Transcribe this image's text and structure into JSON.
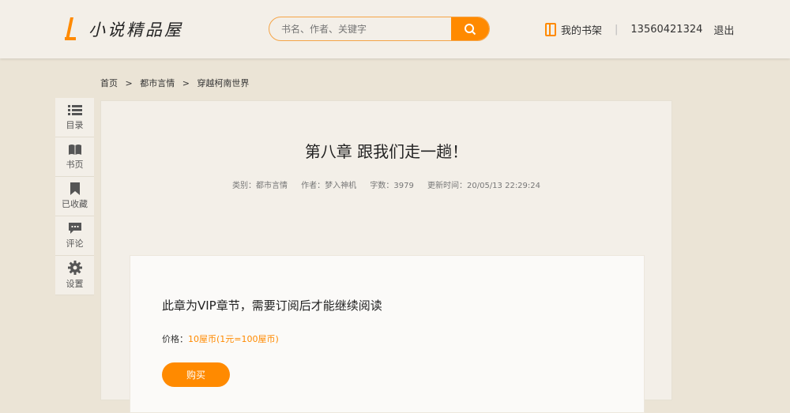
{
  "header": {
    "logo_text": "小说精品屋",
    "search_placeholder": "书名、作者、关键字",
    "bookshelf": "我的书架",
    "separator": "|",
    "phone": "13560421324",
    "logout": "退出"
  },
  "breadcrumb": [
    "首页",
    ">",
    "都市言情",
    ">",
    "穿越柯南世界"
  ],
  "sidebar": [
    {
      "label": "目录",
      "icon": "list-icon"
    },
    {
      "label": "书页",
      "icon": "book-icon"
    },
    {
      "label": "已收藏",
      "icon": "bookmark-icon"
    },
    {
      "label": "评论",
      "icon": "comment-icon"
    },
    {
      "label": "设置",
      "icon": "gear-icon"
    }
  ],
  "chapter": {
    "title": "第八章 跟我们走一趟！",
    "category": "类别：都市言情",
    "author": "作者：梦入神机",
    "words": "字数：3979",
    "updated": "更新时间：20/05/13 22:29:24"
  },
  "vip": {
    "message": "此章为VIP章节，需要订阅后才能继续阅读",
    "price_label": "价格：",
    "price_value": "10屋币(1元=100屋币)",
    "buy": "购买"
  },
  "colors": {
    "accent": "#ff8a00"
  }
}
